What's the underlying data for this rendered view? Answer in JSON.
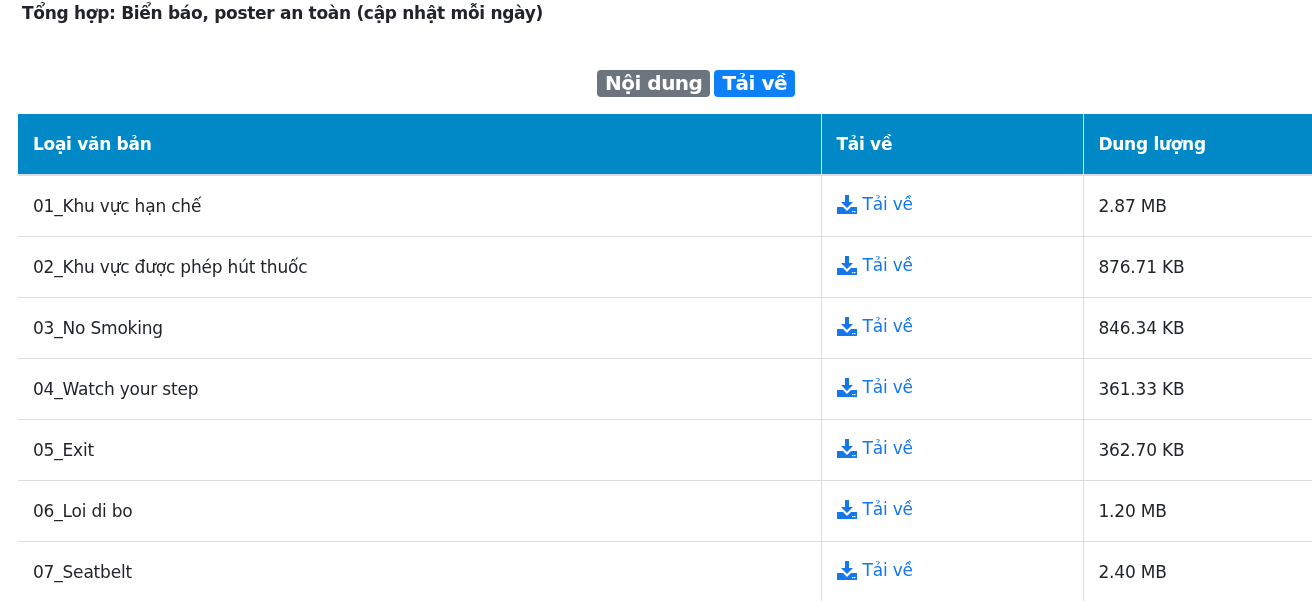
{
  "title": "Tổng hợp: Biển báo, poster an toàn (cập nhật mỗi ngày)",
  "tabs": [
    {
      "label": "Nội dung",
      "selected": false
    },
    {
      "label": "Tải về",
      "selected": true
    }
  ],
  "table": {
    "columns": [
      "Loại văn bản",
      "Tải về",
      "Dung lượng"
    ],
    "rows": [
      {
        "name": "01_Khu vực hạn chế",
        "link": "Tải về",
        "size": "2.87 MB"
      },
      {
        "name": "02_Khu vực được phép hút thuốc",
        "link": "Tải về",
        "size": "876.71 KB"
      },
      {
        "name": "03_No Smoking",
        "link": "Tải về",
        "size": "846.34 KB"
      },
      {
        "name": "04_Watch your step",
        "link": "Tải về",
        "size": "361.33 KB"
      },
      {
        "name": "05_Exit",
        "link": "Tải về",
        "size": "362.70 KB"
      },
      {
        "name": "06_Loi di bo",
        "link": "Tải về",
        "size": "1.20 MB"
      },
      {
        "name": "07_Seatbelt",
        "link": "Tải về",
        "size": "2.40 MB"
      }
    ]
  }
}
